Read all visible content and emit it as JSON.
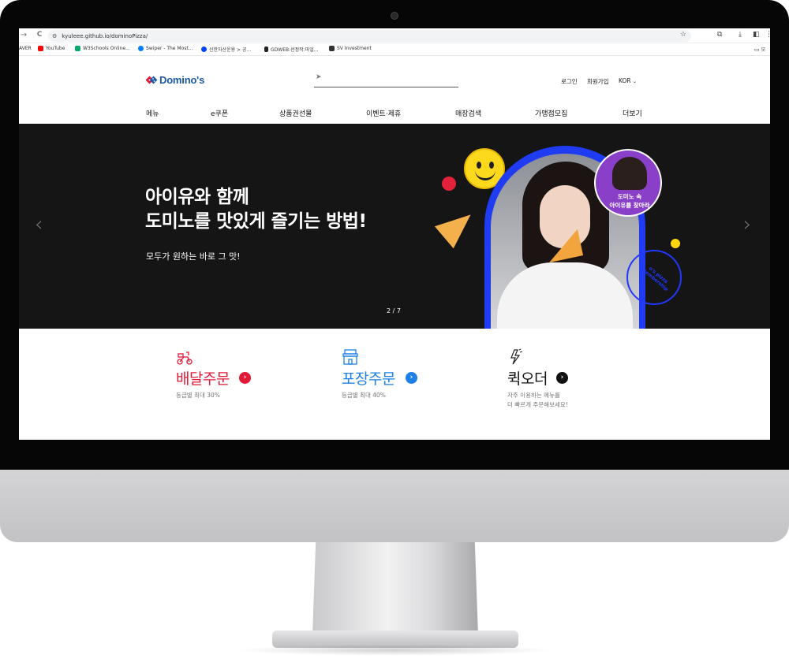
{
  "browser": {
    "back": "→",
    "reload": "C",
    "url": "kyuleee.github.io/dominoPizza/",
    "bookmarks": [
      {
        "label": "AVER",
        "color": "#2db400"
      },
      {
        "label": "YouTube",
        "color": "#ff0000"
      },
      {
        "label": "W3Schools Online...",
        "color": "#04aa6d"
      },
      {
        "label": "Swiper - The Most...",
        "color": "#0080ff"
      },
      {
        "label": "신한자산운용 > 공...",
        "color": "#0046ff"
      },
      {
        "label": "GDWEB:선정작:마일...",
        "color": "#222222"
      },
      {
        "label": "SV Investment",
        "color": "#333333"
      }
    ],
    "bookmark_folder": "모"
  },
  "site": {
    "logo_text": "Domino's",
    "brand_colors": {
      "blue": "#1b58a7",
      "red": "#e31837"
    },
    "search_placeholder": "",
    "util": {
      "login": "로그인",
      "join": "회원가입",
      "lang": "KOR"
    },
    "gnb": [
      "메뉴",
      "e쿠폰",
      "상품권선물",
      "이벤트·제휴",
      "매장검색",
      "가맹점모집",
      "더보기"
    ]
  },
  "hero": {
    "title_line1": "아이유와 함께",
    "title_line2": "도미노를 맛있게 즐기는 방법!",
    "subtitle": "모두가 원하는 바로 그 맛!",
    "pager": "2 / 7",
    "prev": "‹",
    "next": "›",
    "badge_line1": "도미노 속",
    "badge_line2": "아이유를 찾아라",
    "stamp_text": "o's pizza membership"
  },
  "orders": [
    {
      "title": "배달주문",
      "desc": "등급별 최대 30%",
      "color": "#e31837",
      "icon": "delivery-scooter-icon"
    },
    {
      "title": "포장주문",
      "desc": "등급별 최대 40%",
      "color": "#1e7fe8",
      "icon": "store-icon"
    },
    {
      "title": "퀵오더",
      "desc_line1": "자주 이용하는 메뉴를",
      "desc_line2": "더 빠르게 주문해보세요!",
      "color": "#111111",
      "icon": "lightning-icon"
    }
  ]
}
